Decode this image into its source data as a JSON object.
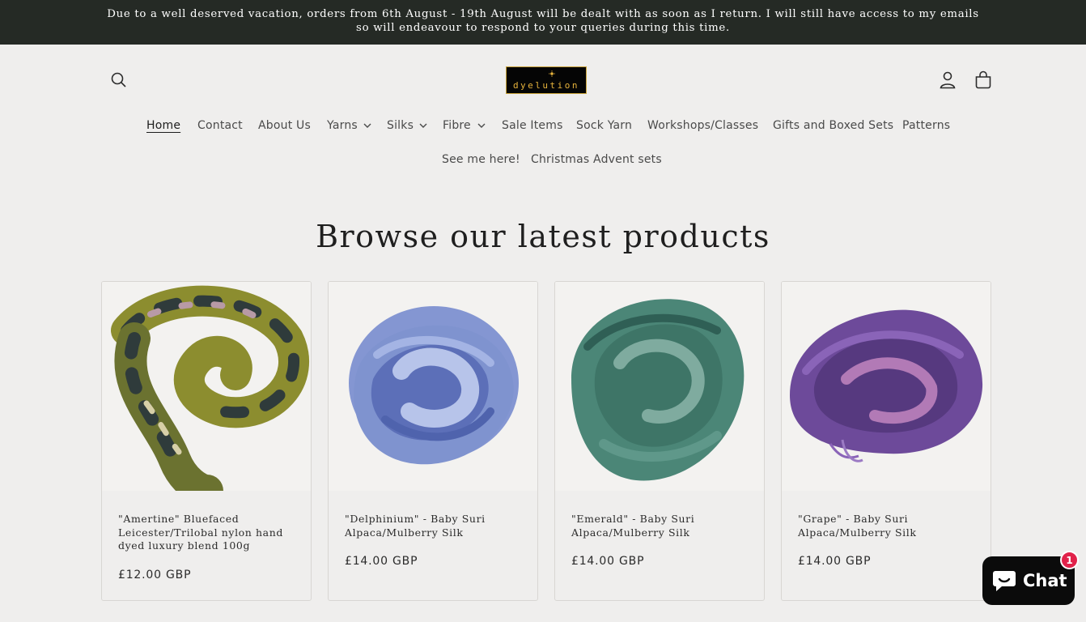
{
  "announcement": {
    "line1": "Due to a well deserved vacation, orders from 6th August - 19th August will be dealt with as soon as I return. I will still have access to my emails",
    "line2": "so will endeavour to respond to your queries during this time."
  },
  "header": {
    "logo_text": "dyelution",
    "icons": [
      "search-icon",
      "account-icon",
      "cart-icon"
    ]
  },
  "nav": {
    "row1": [
      {
        "label": "Home",
        "active": true
      },
      {
        "label": "Contact"
      },
      {
        "label": "About Us"
      },
      {
        "label": "Yarns",
        "dropdown": true
      },
      {
        "label": "Silks",
        "dropdown": true
      },
      {
        "label": "Fibre",
        "dropdown": true
      },
      {
        "label": "Sale Items"
      },
      {
        "label": "Sock Yarn"
      },
      {
        "label": "Workshops/Classes"
      },
      {
        "label": "Gifts and Boxed Sets"
      },
      {
        "label": "Patterns"
      }
    ],
    "row2": [
      {
        "label": "See me here!"
      },
      {
        "label": "Christmas Advent sets"
      }
    ]
  },
  "section": {
    "title": "Browse our latest products"
  },
  "products": [
    {
      "title": "\"Amertine\" Bluefaced Leicester/Trilobal nylon hand dyed luxury blend 100g",
      "price": "£12.00 GBP",
      "colors": [
        "#8c8d2f",
        "#2f3b3b",
        "#b89aa6"
      ]
    },
    {
      "title": "\"Delphinium\" - Baby Suri Alpaca/Mulberry Silk",
      "price": "£14.00 GBP",
      "colors": [
        "#7f93cf",
        "#4f63ad",
        "#b7c4ea"
      ]
    },
    {
      "title": "\"Emerald\" - Baby Suri Alpaca/Mulberry Silk",
      "price": "£14.00 GBP",
      "colors": [
        "#4b8677",
        "#2f5f55",
        "#7fab9f"
      ]
    },
    {
      "title": "\"Grape\" - Baby Suri Alpaca/Mulberry Silk",
      "price": "£14.00 GBP",
      "colors": [
        "#6d4a9a",
        "#4b2f73",
        "#b27ab6"
      ]
    }
  ],
  "chat": {
    "label": "Chat",
    "badge": "1"
  },
  "colors": {
    "background": "#efeeed",
    "announcement_bg": "#252a25",
    "chat_badge": "#e1224a",
    "logo_gold": "#e7b33c"
  }
}
